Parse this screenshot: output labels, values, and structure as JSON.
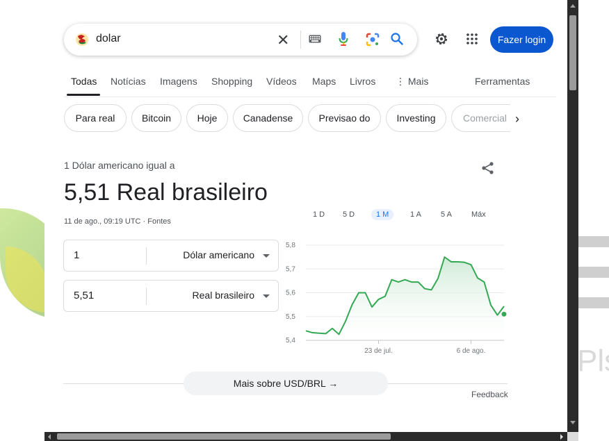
{
  "search": {
    "query": "dolar",
    "icons": [
      "doodle-logo-icon",
      "clear-icon",
      "keyboard-icon",
      "microphone-icon",
      "google-lens-icon",
      "search-icon"
    ]
  },
  "header": {
    "login_label": "Fazer login",
    "icons": [
      "gear-icon",
      "apps-grid-icon"
    ]
  },
  "tabs": [
    {
      "label": "Todas",
      "active": true
    },
    {
      "label": "Notícias"
    },
    {
      "label": "Imagens"
    },
    {
      "label": "Shopping"
    },
    {
      "label": "Vídeos"
    },
    {
      "label": "Maps"
    },
    {
      "label": "Livros"
    },
    {
      "label": "⋮ Mais"
    },
    {
      "label": "Ferramentas"
    }
  ],
  "chips": [
    {
      "label": "Para real"
    },
    {
      "label": "Bitcoin"
    },
    {
      "label": "Hoje"
    },
    {
      "label": "Canadense"
    },
    {
      "label": "Previsao do"
    },
    {
      "label": "Investing"
    },
    {
      "label": "Comercial"
    }
  ],
  "converter": {
    "equals_label": "1 Dólar americano igual a",
    "result": "5,51 Real brasileiro",
    "timestamp": "11 de ago., 09:19 UTC · Fontes",
    "from": {
      "amount": "1",
      "currency": "Dólar americano"
    },
    "to": {
      "amount": "5,51",
      "currency": "Real brasileiro"
    }
  },
  "ranges": [
    {
      "label": "1 D"
    },
    {
      "label": "5 D"
    },
    {
      "label": "1 M",
      "active": true
    },
    {
      "label": "1 A"
    },
    {
      "label": "5 A"
    },
    {
      "label": "Máx"
    }
  ],
  "chart_data": {
    "type": "area",
    "title": "",
    "xlabel": "",
    "ylabel": "",
    "ylim": [
      5.4,
      5.8
    ],
    "yticks": [
      "5,8",
      "5,7",
      "5,6",
      "5,5",
      "5,4"
    ],
    "xticks": [
      "23 de jul.",
      "6 de ago."
    ],
    "x": [
      "2024-07-12",
      "2024-07-13",
      "2024-07-14",
      "2024-07-15",
      "2024-07-16",
      "2024-07-17",
      "2024-07-18",
      "2024-07-19",
      "2024-07-20",
      "2024-07-21",
      "2024-07-22",
      "2024-07-23",
      "2024-07-24",
      "2024-07-25",
      "2024-07-26",
      "2024-07-27",
      "2024-07-28",
      "2024-07-29",
      "2024-07-30",
      "2024-07-31",
      "2024-08-01",
      "2024-08-02",
      "2024-08-03",
      "2024-08-04",
      "2024-08-05",
      "2024-08-06",
      "2024-08-07",
      "2024-08-08",
      "2024-08-09",
      "2024-08-10",
      "2024-08-11"
    ],
    "values": [
      5.44,
      5.432,
      5.43,
      5.428,
      5.45,
      5.425,
      5.48,
      5.55,
      5.6,
      5.6,
      5.54,
      5.572,
      5.585,
      5.655,
      5.645,
      5.655,
      5.645,
      5.645,
      5.617,
      5.612,
      5.66,
      5.75,
      5.73,
      5.73,
      5.728,
      5.718,
      5.662,
      5.645,
      5.548,
      5.506,
      5.543
    ],
    "last_value": 5.51,
    "color": "#34a853",
    "fill": "#e6f4ea",
    "grid": true
  },
  "more": {
    "label": "Mais sobre USD/BRL  →"
  },
  "feedback": "Feedback",
  "colors": {
    "accent": "#0b57d0",
    "line": "#34a853",
    "active_range": "#1a73e8"
  }
}
